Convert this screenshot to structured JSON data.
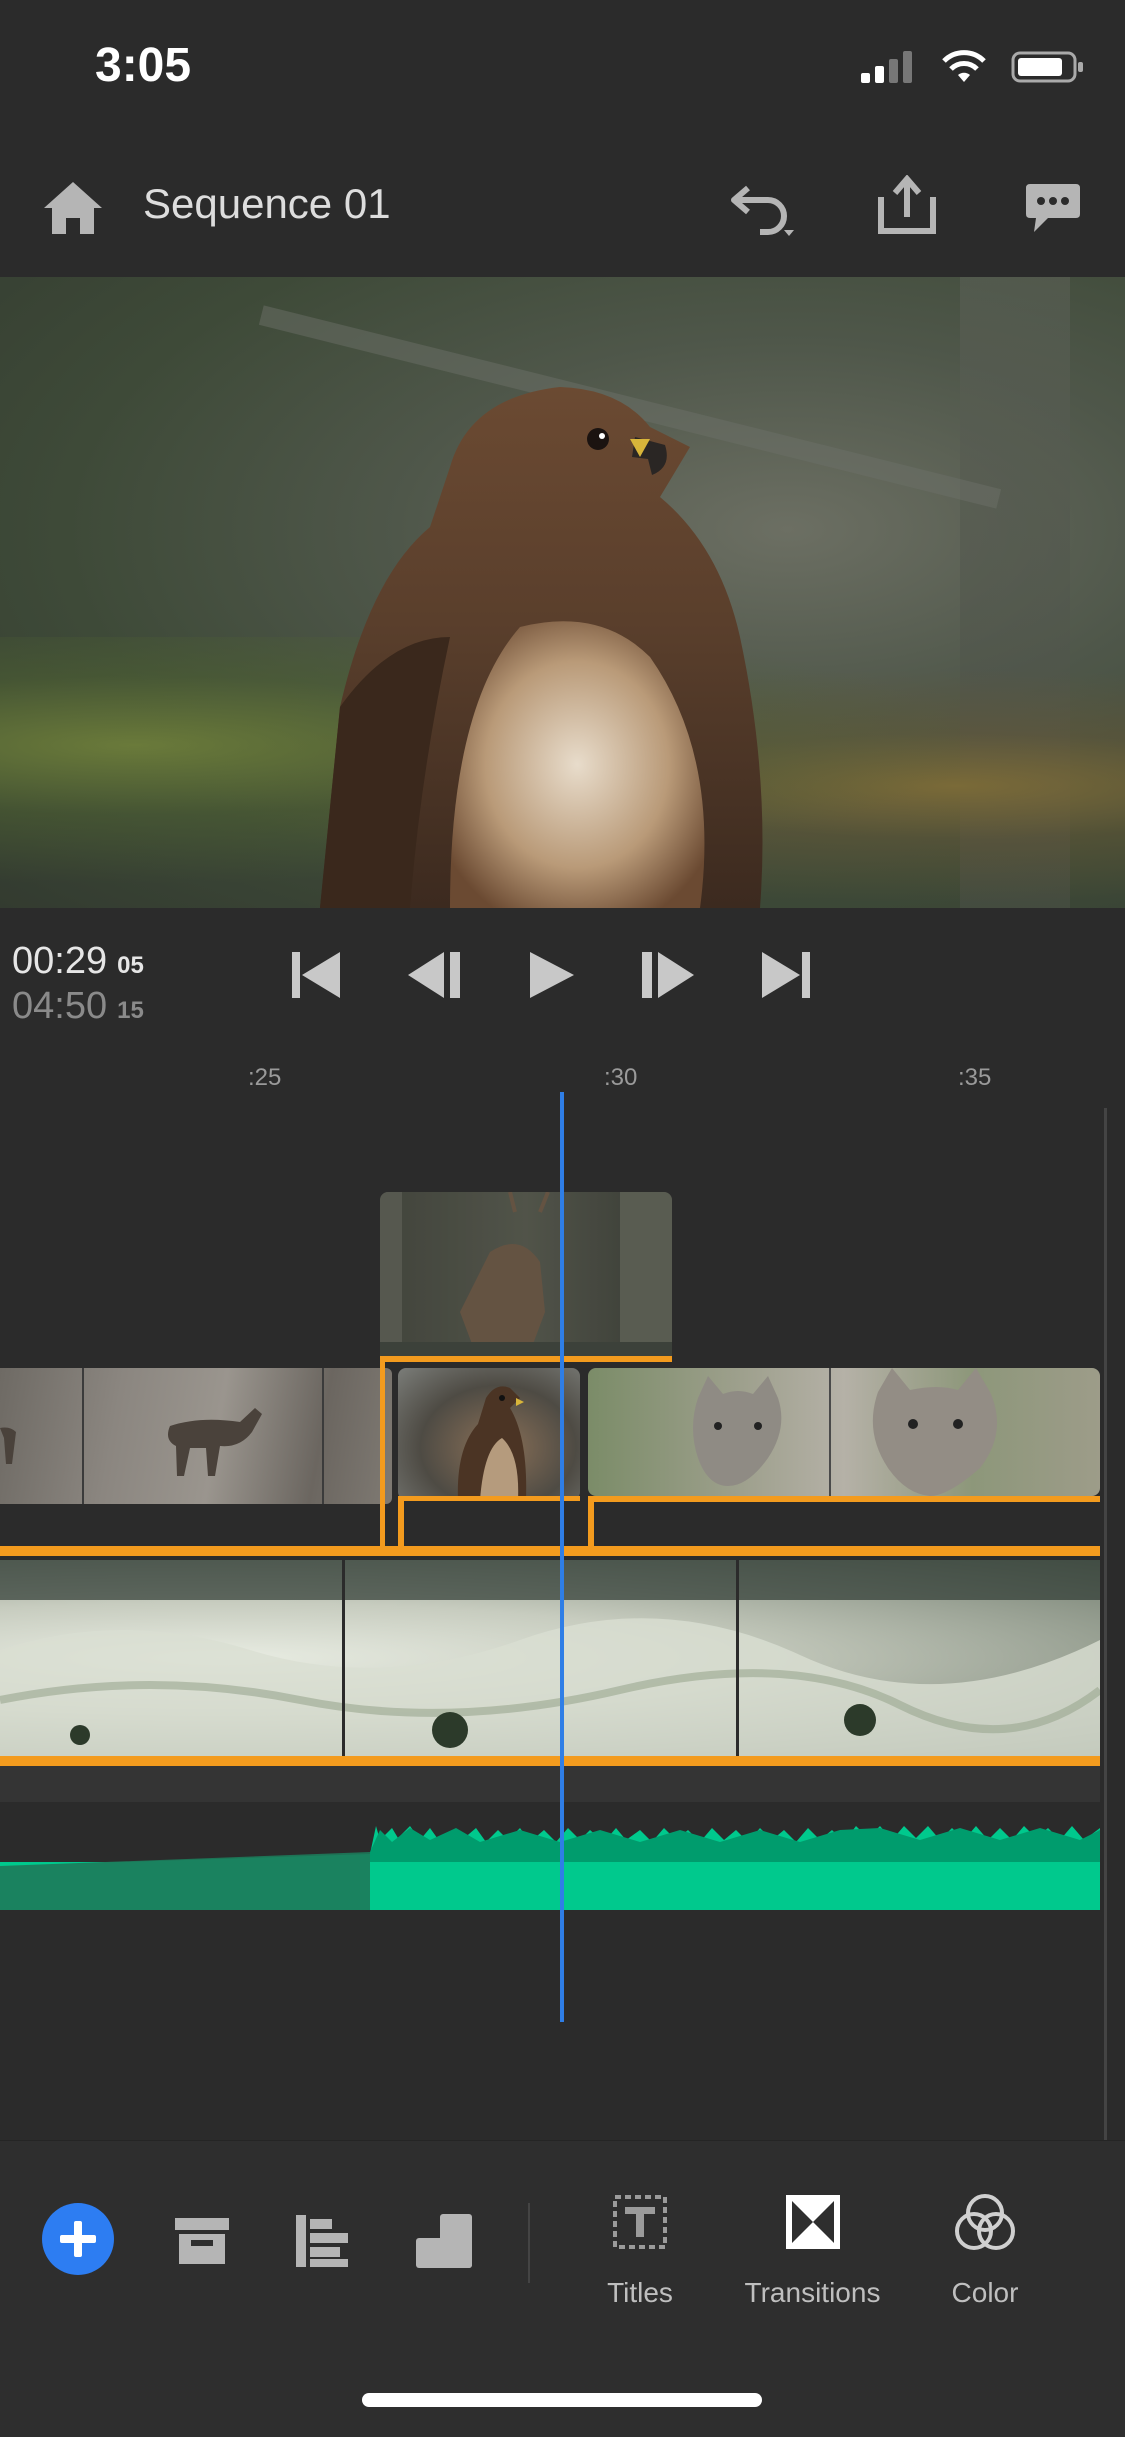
{
  "status_bar": {
    "time": "3:05",
    "icons": [
      "signal-icon",
      "wifi-icon",
      "battery-icon"
    ]
  },
  "header": {
    "title": "Sequence 01",
    "icons": [
      "home-icon",
      "undo-icon",
      "share-icon",
      "feedback-icon"
    ]
  },
  "preview": {
    "subject": "hawk"
  },
  "timecode": {
    "current_main": "00:29",
    "current_frames": "05",
    "total_main": "04:50",
    "total_frames": "15"
  },
  "transport": {
    "icons": [
      "skip-to-start-icon",
      "step-back-icon",
      "play-icon",
      "step-forward-icon",
      "skip-to-end-icon"
    ]
  },
  "ruler": {
    "ticks": [
      ":25",
      ":30",
      ":35"
    ]
  },
  "timeline": {
    "tracks": [
      {
        "name": "overlay",
        "clips": [
          "deer"
        ]
      },
      {
        "name": "main",
        "clips": [
          "deer",
          "hawk",
          "wolf"
        ]
      },
      {
        "name": "b-roll",
        "clips": [
          "water"
        ]
      },
      {
        "name": "audio",
        "clips": [
          "music"
        ]
      }
    ],
    "colors": {
      "selection": "#f39b1e",
      "playhead": "#2f7ee6",
      "audio": "#00c98d",
      "add": "#2d7df2"
    }
  },
  "toolbar": {
    "left_icons": [
      "add-icon",
      "library-icon",
      "tracks-icon",
      "aspect-icon"
    ],
    "tools": [
      {
        "label": "Titles",
        "icon": "titles-icon"
      },
      {
        "label": "Transitions",
        "icon": "transitions-icon"
      },
      {
        "label": "Color",
        "icon": "color-icon"
      }
    ]
  }
}
